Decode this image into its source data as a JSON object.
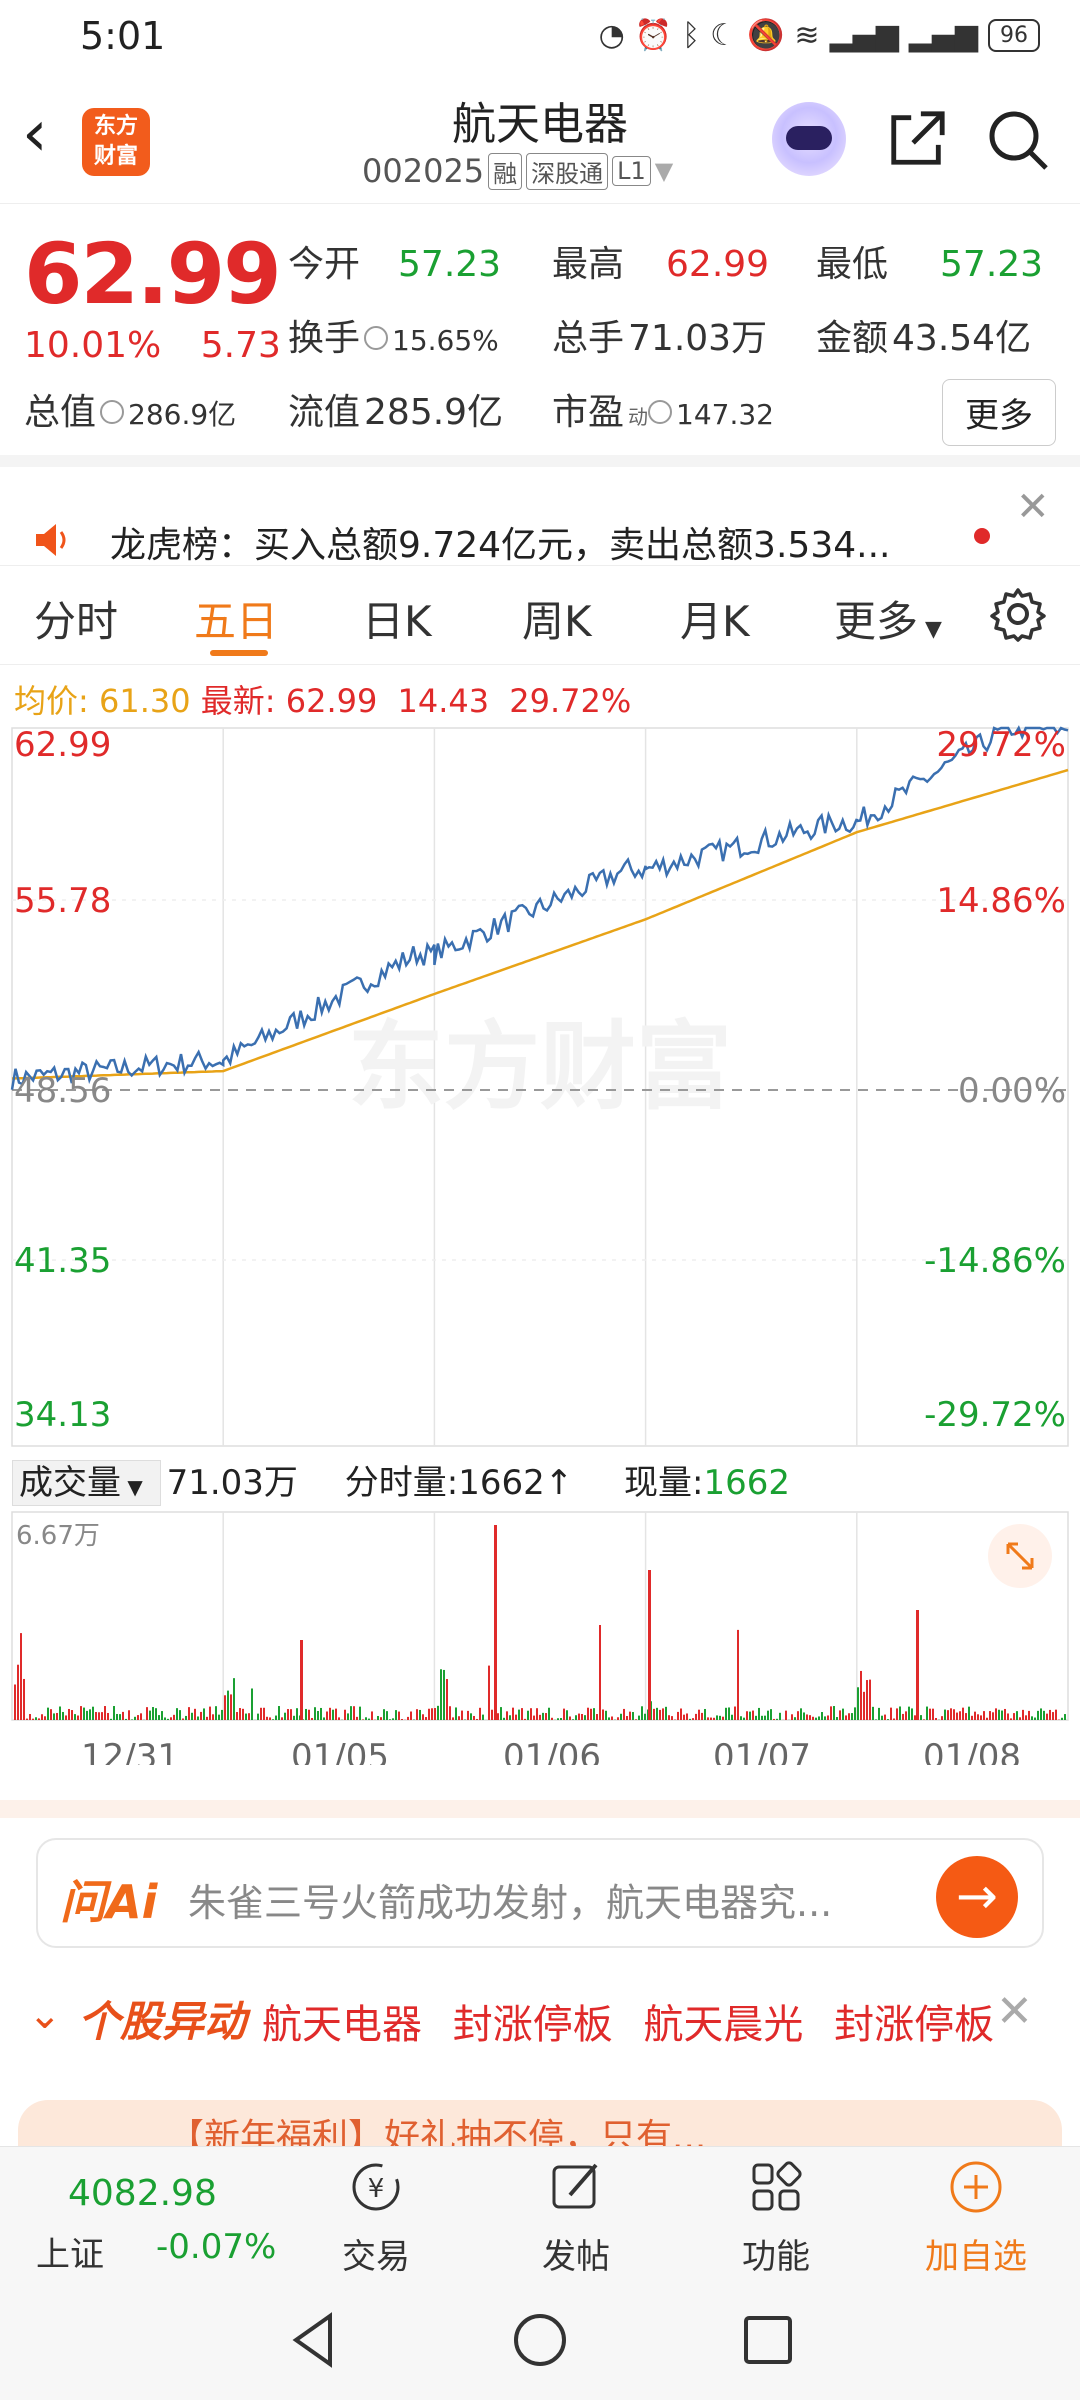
{
  "status_bar": {
    "time": "5:01",
    "battery": "96"
  },
  "nav": {
    "logo_line1": "东方",
    "logo_line2": "财富",
    "stock_name": "航天电器",
    "stock_code": "002025",
    "tags": [
      "融",
      "深股通",
      "L1"
    ]
  },
  "quote": {
    "price": "62.99",
    "change_pct": "10.01%",
    "change": "5.73",
    "open_label": "今开",
    "open": "57.23",
    "high_label": "最高",
    "high": "62.99",
    "low_label": "最低",
    "low": "57.23",
    "turnover_label": "换手",
    "turnover": "15.65%",
    "volume_label": "总手",
    "volume": "71.03万",
    "amount_label": "金额",
    "amount": "43.54亿",
    "mktcap_label": "总值",
    "mktcap": "286.9亿",
    "float_label": "流值",
    "float_cap": "285.9亿",
    "pe_label": "市盈",
    "pe_sup": "动",
    "pe": "147.32",
    "more_label": "更多"
  },
  "notice": {
    "text": "龙虎榜：买入总额9.724亿元，卖出总额3.534..."
  },
  "tabs": {
    "items": [
      "分时",
      "五日",
      "日K",
      "周K",
      "月K",
      "更多"
    ],
    "active": "五日"
  },
  "legend": {
    "avg_label": "均价:",
    "avg": "61.30",
    "latest_label": "最新:",
    "latest": "62.99",
    "chg": "14.43",
    "chg_pct": "29.72%"
  },
  "chart": {
    "watermark": "东方财富",
    "y_left": [
      "62.99",
      "55.78",
      "48.56",
      "41.35",
      "34.13"
    ],
    "y_right": [
      "29.72%",
      "14.86%",
      "0.00%",
      "-14.86%",
      "-29.72%"
    ],
    "dates": [
      "12/31",
      "01/05",
      "01/06",
      "01/07",
      "01/08"
    ],
    "colors": {
      "price": "#3a6fb0",
      "avg": "#e8a317",
      "up": "#e02a2a",
      "down": "#1aa032"
    }
  },
  "chart_data": [
    {
      "type": "line",
      "title": "",
      "x": [
        "12/31",
        "01/05",
        "01/06",
        "01/07",
        "01/08"
      ],
      "series": [
        {
          "values": [
            49.6,
            53.9,
            57.3,
            59.2,
            62.99
          ]
        },
        {
          "values": [
            49.2,
            52.3,
            55.3,
            58.8,
            61.3
          ]
        }
      ],
      "ylim": [
        34.13,
        62.99
      ]
    },
    {
      "type": "bar",
      "title": "",
      "ylabel": "",
      "ylim": [
        0,
        6.67
      ]
    }
  ],
  "volume": {
    "label": "成交量",
    "total": "71.03万",
    "tick_label": "分时量:",
    "tick_val": "1662",
    "now_label": "现量:",
    "now_val": "1662",
    "max": "6.67万"
  },
  "ask": {
    "logo": "问Ai",
    "placeholder": "朱雀三号火箭成功发射，航天电器究..."
  },
  "alert": {
    "title": "个股异动",
    "items": [
      "航天电器",
      "封涨停板",
      "航天晨光",
      "封涨停板"
    ]
  },
  "promo": {
    "text": "【新年福利】好礼抽不停，只有..."
  },
  "bottom_nav": {
    "index_val": "4082.98",
    "index_name": "上证",
    "index_chg": "-0.07%",
    "items": [
      "交易",
      "发帖",
      "功能",
      "加自选"
    ]
  }
}
